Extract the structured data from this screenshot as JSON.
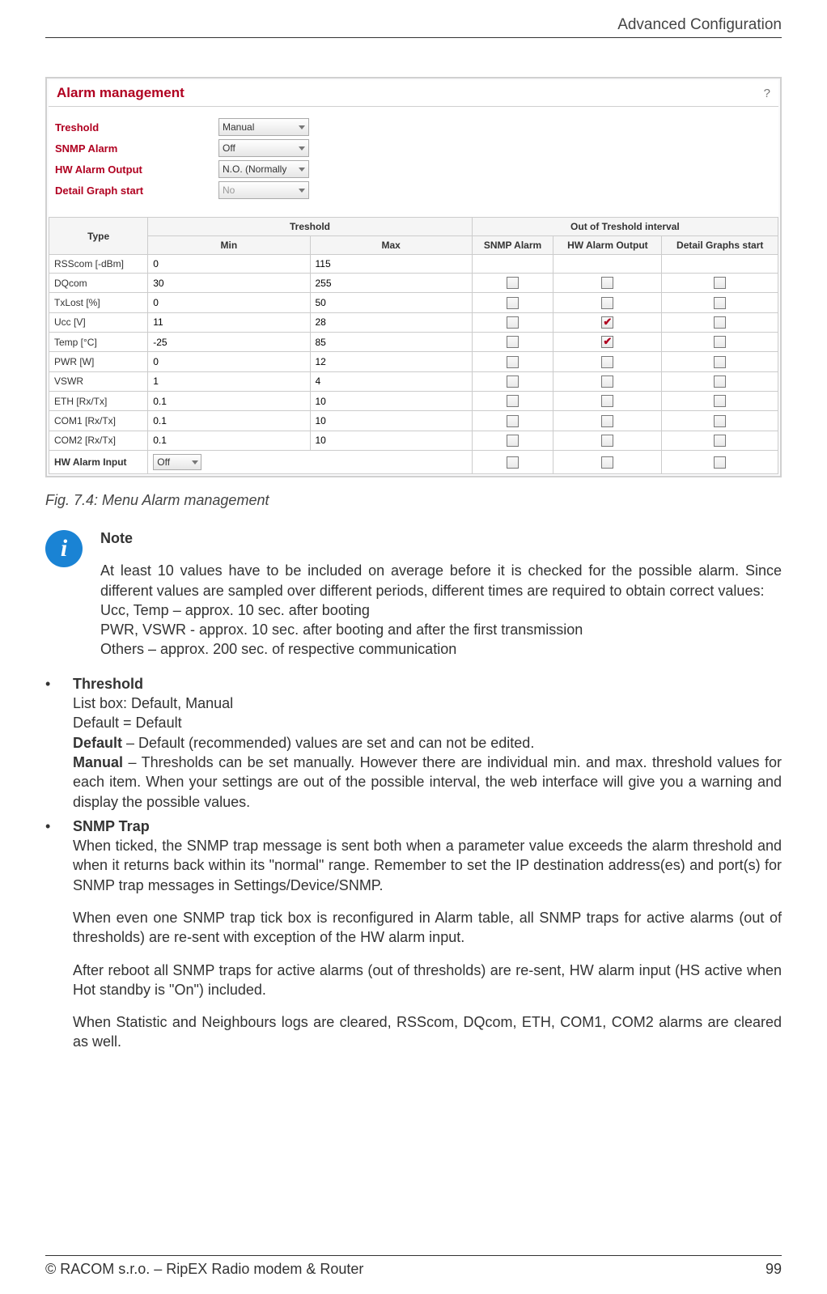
{
  "header": {
    "title": "Advanced Configuration"
  },
  "panel": {
    "title": "Alarm management",
    "help": "?",
    "fields": {
      "threshold": {
        "label": "Treshold",
        "value": "Manual"
      },
      "snmp": {
        "label": "SNMP Alarm",
        "value": "Off"
      },
      "hw_out": {
        "label": "HW Alarm Output",
        "value": "N.O. (Normally"
      },
      "detail": {
        "label": "Detail Graph start",
        "value": "No"
      }
    },
    "table": {
      "headers": {
        "type": "Type",
        "threshold_group": "Treshold",
        "out_group": "Out of Treshold interval",
        "min": "Min",
        "max": "Max",
        "snmp": "SNMP Alarm",
        "hw": "HW Alarm Output",
        "graph": "Detail Graphs start"
      },
      "rows": [
        {
          "type": "RSScom [-dBm]",
          "min": "0",
          "max": "115",
          "snmp": false,
          "hw": false,
          "graph": false,
          "showChecks": false
        },
        {
          "type": "DQcom",
          "min": "30",
          "max": "255",
          "snmp": false,
          "hw": false,
          "graph": false,
          "showChecks": true
        },
        {
          "type": "TxLost [%]",
          "min": "0",
          "max": "50",
          "snmp": false,
          "hw": false,
          "graph": false,
          "showChecks": true
        },
        {
          "type": "Ucc [V]",
          "min": "11",
          "max": "28",
          "snmp": false,
          "hw": true,
          "graph": false,
          "showChecks": true
        },
        {
          "type": "Temp [°C]",
          "min": "-25",
          "max": "85",
          "snmp": false,
          "hw": true,
          "graph": false,
          "showChecks": true
        },
        {
          "type": "PWR [W]",
          "min": "0",
          "max": "12",
          "snmp": false,
          "hw": false,
          "graph": false,
          "showChecks": true
        },
        {
          "type": "VSWR",
          "min": "1",
          "max": "4",
          "snmp": false,
          "hw": false,
          "graph": false,
          "showChecks": true
        },
        {
          "type": "ETH [Rx/Tx]",
          "min": "0.1",
          "max": "10",
          "snmp": false,
          "hw": false,
          "graph": false,
          "showChecks": true
        },
        {
          "type": "COM1 [Rx/Tx]",
          "min": "0.1",
          "max": "10",
          "snmp": false,
          "hw": false,
          "graph": false,
          "showChecks": true
        },
        {
          "type": "COM2 [Rx/Tx]",
          "min": "0.1",
          "max": "10",
          "snmp": false,
          "hw": false,
          "graph": false,
          "showChecks": true
        }
      ],
      "hwInput": {
        "label": "HW Alarm Input",
        "value": "Off",
        "snmp": false,
        "hw": false,
        "graph": false
      }
    }
  },
  "caption": "Fig. 7.4: Menu Alarm management",
  "note": {
    "title": "Note",
    "p1": "At least 10 values have to be included on average before it is checked for the possible alarm. Since different values are sampled over different periods, different times are required to obtain correct values:",
    "l1": "Ucc, Temp – approx. 10 sec. after booting",
    "l2": "PWR, VSWR - approx. 10 sec. after booting and after the first transmission",
    "l3": "Others – approx. 200 sec. of respective communication"
  },
  "bullets": {
    "threshold": {
      "title": "Threshold",
      "l1": "List box: Default, Manual",
      "l2": "Default = Default",
      "default_bold": "Default",
      "default_text": " – Default (recommended) values are set and can not be edited.",
      "manual_bold": "Manual",
      "manual_text": " – Thresholds can be set manually. However there are individual min. and max. threshold values for each item. When your settings are out of the possible interval, the web interface will give you a warning and display the possible values."
    },
    "snmp": {
      "title": "SNMP Trap",
      "p1": "When ticked, the SNMP trap message is sent both when a parameter value exceeds the alarm threshold and when it returns back within its \"normal\" range. Remember to set the IP destination address(es) and port(s) for SNMP trap messages in Settings/Device/SNMP.",
      "p2": "When even one SNMP trap tick box is reconfigured in Alarm table, all SNMP traps for active alarms (out of thresholds) are re-sent with exception of the HW alarm input.",
      "p3": "After reboot all SNMP traps for active alarms (out of thresholds) are re-sent, HW alarm input (HS active when Hot standby is \"On\") included.",
      "p4": "When Statistic and Neighbours logs are cleared, RSScom, DQcom, ETH, COM1, COM2 alarms are cleared as well."
    }
  },
  "footer": {
    "left": "© RACOM s.r.o. – RipEX Radio modem & Router",
    "right": "99"
  }
}
